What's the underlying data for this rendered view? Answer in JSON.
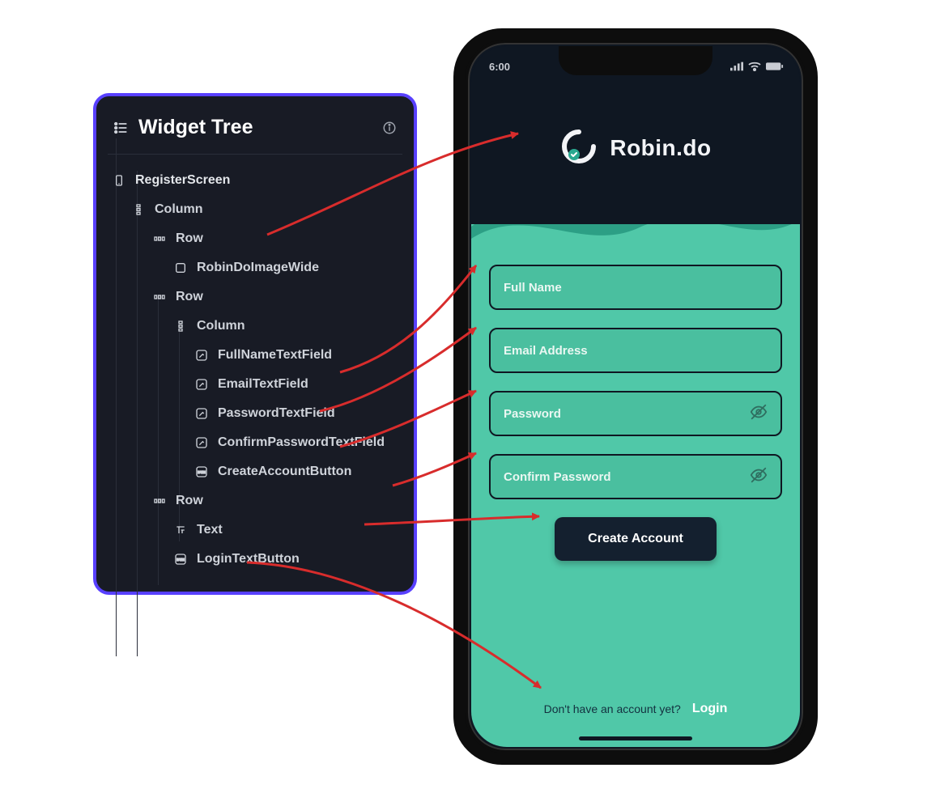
{
  "tree": {
    "title": "Widget Tree",
    "root": "RegisterScreen",
    "nodes": {
      "column1": "Column",
      "row1": "Row",
      "robin_image": "RobinDoImageWide",
      "row2": "Row",
      "column2": "Column",
      "fullname": "FullNameTextField",
      "email": "EmailTextField",
      "password": "PasswordTextField",
      "confirm": "ConfirmPasswordTextField",
      "create_btn": "CreateAccountButton",
      "row3": "Row",
      "text": "Text",
      "login_btn": "LoginTextButton"
    }
  },
  "phone": {
    "time": "6:00",
    "app_name": "Robin.do",
    "fields": {
      "fullname": "Full Name",
      "email": "Email Address",
      "password": "Password",
      "confirm": "Confirm Password"
    },
    "create_label": "Create Account",
    "footer_text": "Don't have an account yet?",
    "footer_link": "Login"
  }
}
